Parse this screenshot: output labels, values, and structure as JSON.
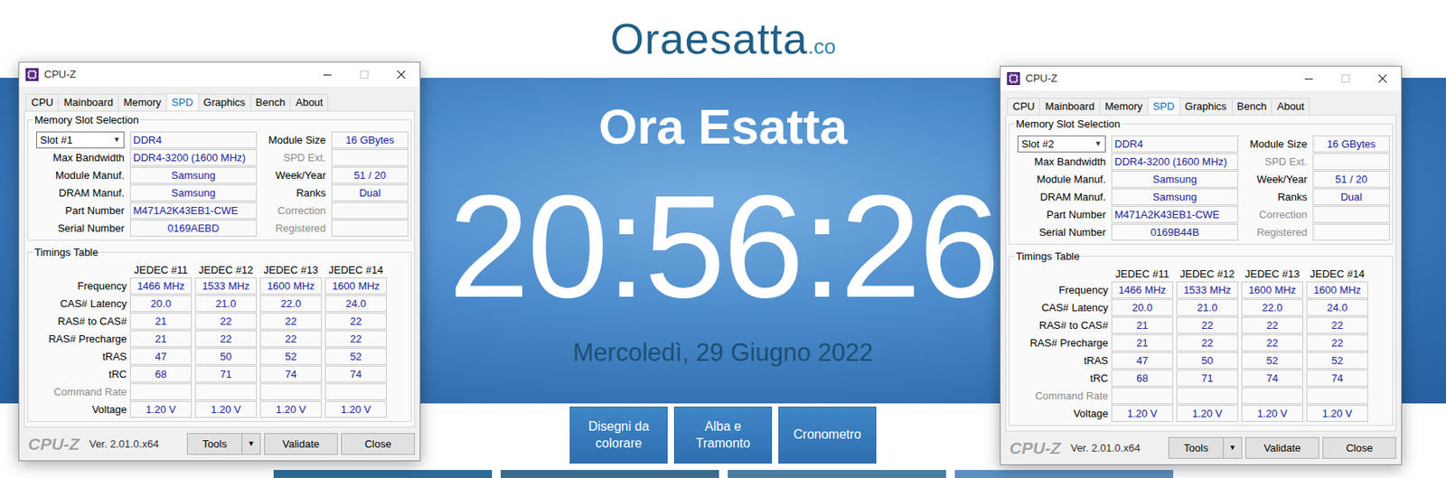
{
  "site": {
    "logo": "Oraesatta",
    "logo_suffix": ".co",
    "heading": "Ora Esatta",
    "time": "20:56:26",
    "date": "Mercoledì, 29 Giugno 2022",
    "buttons": [
      "Disegni da colorare",
      "Alba e Tramonto",
      "Cronometro"
    ]
  },
  "windows": [
    {
      "title": "CPU-Z",
      "window_buttons": [
        {
          "kind": "minimize",
          "disabled": false
        },
        {
          "kind": "maximize",
          "disabled": true
        },
        {
          "kind": "close",
          "disabled": false
        }
      ],
      "tabs": [
        {
          "label": "CPU",
          "selected": false
        },
        {
          "label": "Mainboard",
          "selected": false
        },
        {
          "label": "Memory",
          "selected": false
        },
        {
          "label": "SPD",
          "selected": true
        },
        {
          "label": "Graphics",
          "selected": false
        },
        {
          "label": "Bench",
          "selected": false
        },
        {
          "label": "About",
          "selected": false
        }
      ],
      "slot_group": {
        "title": "Memory Slot Selection",
        "slot": "Slot #1",
        "slot_arrow": "▼",
        "type": "DDR4",
        "left_fields": [
          {
            "label": "Max Bandwidth",
            "value": "DDR4-3200 (1600 MHz)"
          },
          {
            "label": "Module Manuf.",
            "value": "Samsung"
          },
          {
            "label": "DRAM Manuf.",
            "value": "Samsung"
          },
          {
            "label": "Part Number",
            "value": "M471A2K43EB1-CWE"
          },
          {
            "label": "Serial Number",
            "value": "0169AEBD"
          }
        ],
        "right_fields": [
          {
            "label": "Module Size",
            "value": "16 GBytes",
            "disabled": false
          },
          {
            "label": "SPD Ext.",
            "value": "",
            "disabled": true
          },
          {
            "label": "Week/Year",
            "value": "51 / 20",
            "disabled": false
          },
          {
            "label": "Ranks",
            "value": "Dual",
            "disabled": false
          },
          {
            "label": "Correction",
            "value": "",
            "disabled": true
          },
          {
            "label": "Registered",
            "value": "",
            "disabled": true
          }
        ]
      },
      "timings": {
        "title": "Timings Table",
        "columns": [
          "JEDEC #11",
          "JEDEC #12",
          "JEDEC #13",
          "JEDEC #14"
        ],
        "rows": [
          {
            "label": "Frequency",
            "values": [
              "1466 MHz",
              "1533 MHz",
              "1600 MHz",
              "1600 MHz"
            ],
            "disabled": false
          },
          {
            "label": "CAS# Latency",
            "values": [
              "20.0",
              "21.0",
              "22.0",
              "24.0"
            ],
            "disabled": false
          },
          {
            "label": "RAS# to CAS#",
            "values": [
              "21",
              "22",
              "22",
              "22"
            ],
            "disabled": false
          },
          {
            "label": "RAS# Precharge",
            "values": [
              "21",
              "22",
              "22",
              "22"
            ],
            "disabled": false
          },
          {
            "label": "tRAS",
            "values": [
              "47",
              "50",
              "52",
              "52"
            ],
            "disabled": false
          },
          {
            "label": "tRC",
            "values": [
              "68",
              "71",
              "74",
              "74"
            ],
            "disabled": false
          },
          {
            "label": "Command Rate",
            "values": [
              "",
              "",
              "",
              ""
            ],
            "disabled": true
          },
          {
            "label": "Voltage",
            "values": [
              "1.20 V",
              "1.20 V",
              "1.20 V",
              "1.20 V"
            ],
            "disabled": false
          }
        ]
      },
      "footer": {
        "logo": "CPU-Z",
        "version": "Ver. 2.01.0.x64",
        "tools": "Tools",
        "tools_arrow": "▼",
        "buttons": [
          "Validate",
          "Close"
        ]
      }
    },
    {
      "title": "CPU-Z",
      "window_buttons": [
        {
          "kind": "minimize",
          "disabled": false
        },
        {
          "kind": "maximize",
          "disabled": true
        },
        {
          "kind": "close",
          "disabled": false
        }
      ],
      "tabs": [
        {
          "label": "CPU",
          "selected": false
        },
        {
          "label": "Mainboard",
          "selected": false
        },
        {
          "label": "Memory",
          "selected": false
        },
        {
          "label": "SPD",
          "selected": true
        },
        {
          "label": "Graphics",
          "selected": false
        },
        {
          "label": "Bench",
          "selected": false
        },
        {
          "label": "About",
          "selected": false
        }
      ],
      "slot_group": {
        "title": "Memory Slot Selection",
        "slot": "Slot #2",
        "slot_arrow": "▼",
        "type": "DDR4",
        "left_fields": [
          {
            "label": "Max Bandwidth",
            "value": "DDR4-3200 (1600 MHz)"
          },
          {
            "label": "Module Manuf.",
            "value": "Samsung"
          },
          {
            "label": "DRAM Manuf.",
            "value": "Samsung"
          },
          {
            "label": "Part Number",
            "value": "M471A2K43EB1-CWE"
          },
          {
            "label": "Serial Number",
            "value": "0169B44B"
          }
        ],
        "right_fields": [
          {
            "label": "Module Size",
            "value": "16 GBytes",
            "disabled": false
          },
          {
            "label": "SPD Ext.",
            "value": "",
            "disabled": true
          },
          {
            "label": "Week/Year",
            "value": "51 / 20",
            "disabled": false
          },
          {
            "label": "Ranks",
            "value": "Dual",
            "disabled": false
          },
          {
            "label": "Correction",
            "value": "",
            "disabled": true
          },
          {
            "label": "Registered",
            "value": "",
            "disabled": true
          }
        ]
      },
      "timings": {
        "title": "Timings Table",
        "columns": [
          "JEDEC #11",
          "JEDEC #12",
          "JEDEC #13",
          "JEDEC #14"
        ],
        "rows": [
          {
            "label": "Frequency",
            "values": [
              "1466 MHz",
              "1533 MHz",
              "1600 MHz",
              "1600 MHz"
            ],
            "disabled": false
          },
          {
            "label": "CAS# Latency",
            "values": [
              "20.0",
              "21.0",
              "22.0",
              "24.0"
            ],
            "disabled": false
          },
          {
            "label": "RAS# to CAS#",
            "values": [
              "21",
              "22",
              "22",
              "22"
            ],
            "disabled": false
          },
          {
            "label": "RAS# Precharge",
            "values": [
              "21",
              "22",
              "22",
              "22"
            ],
            "disabled": false
          },
          {
            "label": "tRAS",
            "values": [
              "47",
              "50",
              "52",
              "52"
            ],
            "disabled": false
          },
          {
            "label": "tRC",
            "values": [
              "68",
              "71",
              "74",
              "74"
            ],
            "disabled": false
          },
          {
            "label": "Command Rate",
            "values": [
              "",
              "",
              "",
              ""
            ],
            "disabled": true
          },
          {
            "label": "Voltage",
            "values": [
              "1.20 V",
              "1.20 V",
              "1.20 V",
              "1.20 V"
            ],
            "disabled": false
          }
        ]
      },
      "footer": {
        "logo": "CPU-Z",
        "version": "Ver. 2.01.0.x64",
        "tools": "Tools",
        "tools_arrow": "▼",
        "buttons": [
          "Validate",
          "Close"
        ]
      }
    }
  ]
}
